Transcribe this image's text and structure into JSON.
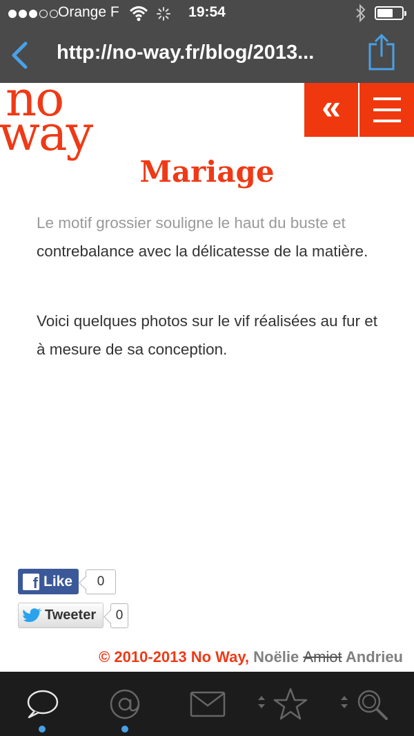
{
  "status_bar": {
    "carrier": "Orange F",
    "time": "19:54",
    "signal_bars_filled": 3,
    "signal_bars_total": 5,
    "battery_level": 0.65
  },
  "browser": {
    "url": "http://no-way.fr/blog/2013..."
  },
  "site": {
    "logo_line1": "no",
    "logo_line2": "way",
    "prev_glyph": "«",
    "accent_color": "#f0380f"
  },
  "article": {
    "title": "Mariage",
    "p1_muted": "Le motif grossier souligne le haut du buste et",
    "p1_rest": "contrebalance avec la délicatesse de la matière.",
    "p2": "Voici quelques photos sur le vif réalisées au fur et à mesure de sa conception."
  },
  "social": {
    "like_label": "Like",
    "like_count": "0",
    "tweet_label": "Tweeter",
    "tweet_count": "0"
  },
  "footer": {
    "copyright": "© 2010-2013 No Way,",
    "name_first": "Noëlie",
    "name_struck": "Amiot",
    "name_last": "Andrieu"
  },
  "tabbar": {
    "tabs": [
      {
        "icon": "speech-bubble-icon",
        "indicator": true
      },
      {
        "icon": "at-sign-icon",
        "indicator": true
      },
      {
        "icon": "envelope-icon",
        "indicator": false
      },
      {
        "icon": "star-icon",
        "indicator": false
      },
      {
        "icon": "magnifier-icon",
        "indicator": false
      }
    ]
  }
}
